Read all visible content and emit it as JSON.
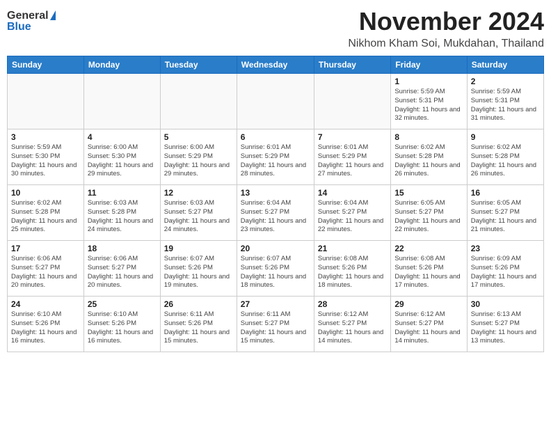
{
  "header": {
    "logo_general": "General",
    "logo_blue": "Blue",
    "month_title": "November 2024",
    "location": "Nikhom Kham Soi, Mukdahan, Thailand"
  },
  "days_of_week": [
    "Sunday",
    "Monday",
    "Tuesday",
    "Wednesday",
    "Thursday",
    "Friday",
    "Saturday"
  ],
  "weeks": [
    [
      {
        "day": "",
        "info": ""
      },
      {
        "day": "",
        "info": ""
      },
      {
        "day": "",
        "info": ""
      },
      {
        "day": "",
        "info": ""
      },
      {
        "day": "",
        "info": ""
      },
      {
        "day": "1",
        "info": "Sunrise: 5:59 AM\nSunset: 5:31 PM\nDaylight: 11 hours and 32 minutes."
      },
      {
        "day": "2",
        "info": "Sunrise: 5:59 AM\nSunset: 5:31 PM\nDaylight: 11 hours and 31 minutes."
      }
    ],
    [
      {
        "day": "3",
        "info": "Sunrise: 5:59 AM\nSunset: 5:30 PM\nDaylight: 11 hours and 30 minutes."
      },
      {
        "day": "4",
        "info": "Sunrise: 6:00 AM\nSunset: 5:30 PM\nDaylight: 11 hours and 29 minutes."
      },
      {
        "day": "5",
        "info": "Sunrise: 6:00 AM\nSunset: 5:29 PM\nDaylight: 11 hours and 29 minutes."
      },
      {
        "day": "6",
        "info": "Sunrise: 6:01 AM\nSunset: 5:29 PM\nDaylight: 11 hours and 28 minutes."
      },
      {
        "day": "7",
        "info": "Sunrise: 6:01 AM\nSunset: 5:29 PM\nDaylight: 11 hours and 27 minutes."
      },
      {
        "day": "8",
        "info": "Sunrise: 6:02 AM\nSunset: 5:28 PM\nDaylight: 11 hours and 26 minutes."
      },
      {
        "day": "9",
        "info": "Sunrise: 6:02 AM\nSunset: 5:28 PM\nDaylight: 11 hours and 26 minutes."
      }
    ],
    [
      {
        "day": "10",
        "info": "Sunrise: 6:02 AM\nSunset: 5:28 PM\nDaylight: 11 hours and 25 minutes."
      },
      {
        "day": "11",
        "info": "Sunrise: 6:03 AM\nSunset: 5:28 PM\nDaylight: 11 hours and 24 minutes."
      },
      {
        "day": "12",
        "info": "Sunrise: 6:03 AM\nSunset: 5:27 PM\nDaylight: 11 hours and 24 minutes."
      },
      {
        "day": "13",
        "info": "Sunrise: 6:04 AM\nSunset: 5:27 PM\nDaylight: 11 hours and 23 minutes."
      },
      {
        "day": "14",
        "info": "Sunrise: 6:04 AM\nSunset: 5:27 PM\nDaylight: 11 hours and 22 minutes."
      },
      {
        "day": "15",
        "info": "Sunrise: 6:05 AM\nSunset: 5:27 PM\nDaylight: 11 hours and 22 minutes."
      },
      {
        "day": "16",
        "info": "Sunrise: 6:05 AM\nSunset: 5:27 PM\nDaylight: 11 hours and 21 minutes."
      }
    ],
    [
      {
        "day": "17",
        "info": "Sunrise: 6:06 AM\nSunset: 5:27 PM\nDaylight: 11 hours and 20 minutes."
      },
      {
        "day": "18",
        "info": "Sunrise: 6:06 AM\nSunset: 5:27 PM\nDaylight: 11 hours and 20 minutes."
      },
      {
        "day": "19",
        "info": "Sunrise: 6:07 AM\nSunset: 5:26 PM\nDaylight: 11 hours and 19 minutes."
      },
      {
        "day": "20",
        "info": "Sunrise: 6:07 AM\nSunset: 5:26 PM\nDaylight: 11 hours and 18 minutes."
      },
      {
        "day": "21",
        "info": "Sunrise: 6:08 AM\nSunset: 5:26 PM\nDaylight: 11 hours and 18 minutes."
      },
      {
        "day": "22",
        "info": "Sunrise: 6:08 AM\nSunset: 5:26 PM\nDaylight: 11 hours and 17 minutes."
      },
      {
        "day": "23",
        "info": "Sunrise: 6:09 AM\nSunset: 5:26 PM\nDaylight: 11 hours and 17 minutes."
      }
    ],
    [
      {
        "day": "24",
        "info": "Sunrise: 6:10 AM\nSunset: 5:26 PM\nDaylight: 11 hours and 16 minutes."
      },
      {
        "day": "25",
        "info": "Sunrise: 6:10 AM\nSunset: 5:26 PM\nDaylight: 11 hours and 16 minutes."
      },
      {
        "day": "26",
        "info": "Sunrise: 6:11 AM\nSunset: 5:26 PM\nDaylight: 11 hours and 15 minutes."
      },
      {
        "day": "27",
        "info": "Sunrise: 6:11 AM\nSunset: 5:27 PM\nDaylight: 11 hours and 15 minutes."
      },
      {
        "day": "28",
        "info": "Sunrise: 6:12 AM\nSunset: 5:27 PM\nDaylight: 11 hours and 14 minutes."
      },
      {
        "day": "29",
        "info": "Sunrise: 6:12 AM\nSunset: 5:27 PM\nDaylight: 11 hours and 14 minutes."
      },
      {
        "day": "30",
        "info": "Sunrise: 6:13 AM\nSunset: 5:27 PM\nDaylight: 11 hours and 13 minutes."
      }
    ]
  ]
}
